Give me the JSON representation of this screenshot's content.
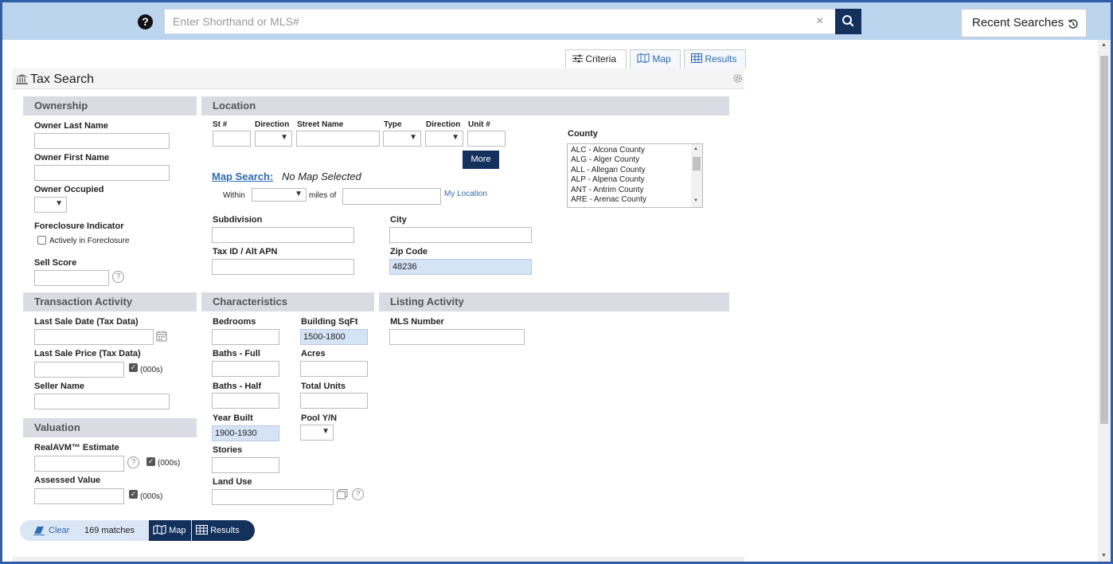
{
  "topbar": {
    "help_icon": "?",
    "search_placeholder": "Enter Shorthand or MLS#",
    "clear_icon": "×",
    "recent_label": "Recent Searches"
  },
  "view_tabs": {
    "criteria": "Criteria",
    "map": "Map",
    "results": "Results"
  },
  "panel": {
    "title": "Tax Search"
  },
  "ownership": {
    "heading": "Ownership",
    "owner_last_name": "Owner Last Name",
    "owner_first_name": "Owner First Name",
    "owner_occupied": "Owner Occupied",
    "foreclosure_indicator": "Foreclosure Indicator",
    "actively_in_foreclosure": "Actively in Foreclosure",
    "sell_score": "Sell Score"
  },
  "location": {
    "heading": "Location",
    "st_num": "St #",
    "direction1": "Direction",
    "street_name": "Street Name",
    "type": "Type",
    "direction2": "Direction",
    "unit_num": "Unit #",
    "more_button": "More",
    "map_search_link": "Map Search:",
    "no_map_selected": "No Map Selected",
    "within": "Within",
    "miles_of": "miles of",
    "my_location": "My Location",
    "subdivision": "Subdivision",
    "city": "City",
    "tax_id": "Tax ID / Alt APN",
    "zip_code": "Zip Code",
    "zip_value": "48236",
    "county": "County",
    "county_options": [
      "ALC - Alcona County",
      "ALG - Alger County",
      "ALL - Allegan County",
      "ALP - Alpena County",
      "ANT - Antrim County",
      "ARE - Arenac County"
    ]
  },
  "transaction": {
    "heading": "Transaction Activity",
    "last_sale_date": "Last Sale Date (Tax Data)",
    "last_sale_price": "Last Sale Price (Tax Data)",
    "units_000s": "(000s)",
    "seller_name": "Seller Name"
  },
  "valuation": {
    "heading": "Valuation",
    "realavm": "RealAVM™ Estimate",
    "units_000s": "(000s)",
    "assessed_value": "Assessed Value"
  },
  "characteristics": {
    "heading": "Characteristics",
    "bedrooms": "Bedrooms",
    "building_sqft": "Building SqFt",
    "building_sqft_value": "1500-1800",
    "baths_full": "Baths - Full",
    "acres": "Acres",
    "baths_half": "Baths - Half",
    "total_units": "Total Units",
    "year_built": "Year Built",
    "year_built_value": "1900-1930",
    "pool": "Pool Y/N",
    "stories": "Stories",
    "land_use": "Land Use"
  },
  "listing_activity": {
    "heading": "Listing Activity",
    "mls_number": "MLS Number"
  },
  "bottom_bar": {
    "clear": "Clear",
    "matches": "169 matches",
    "map": "Map",
    "results": "Results"
  },
  "colors": {
    "accent_dark": "#14305c",
    "topbar_bg": "#bcd4ee",
    "link": "#2d6bb3",
    "filled_input": "#d5e3f6",
    "section_bg": "#d9dde3"
  }
}
